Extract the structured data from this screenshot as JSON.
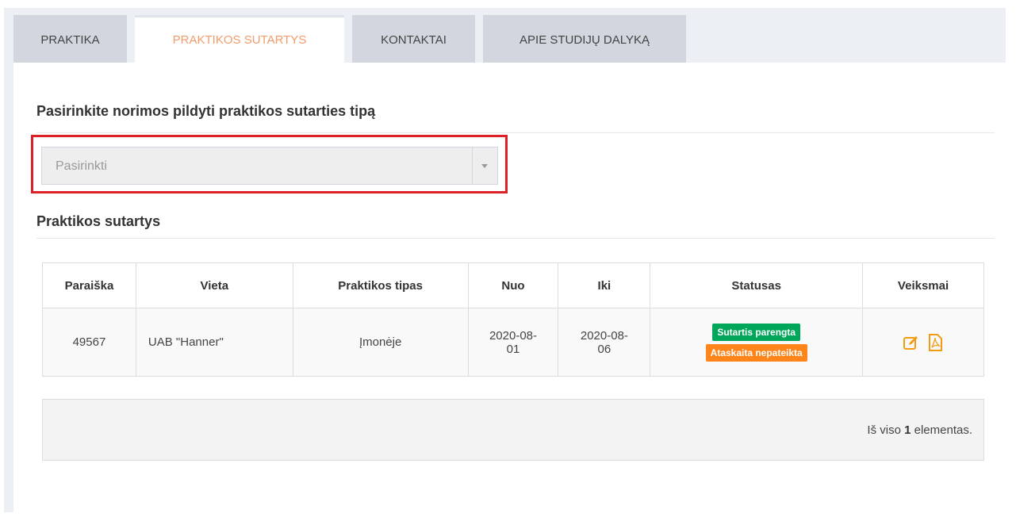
{
  "tabs": [
    {
      "label": "PRAKTIKA",
      "active": false
    },
    {
      "label": "PRAKTIKOS SUTARTYS",
      "active": true
    },
    {
      "label": "KONTAKTAI",
      "active": false
    },
    {
      "label": "APIE STUDIJŲ DALYKĄ",
      "active": false
    }
  ],
  "type_section": {
    "title": "Pasirinkite norimos pildyti praktikos sutarties tipą",
    "select_placeholder": "Pasirinkti"
  },
  "contracts_section": {
    "title": "Praktikos sutartys",
    "columns": [
      "Paraiška",
      "Vieta",
      "Praktikos tipas",
      "Nuo",
      "Iki",
      "Statusas",
      "Veiksmai"
    ],
    "rows": [
      {
        "application": "49567",
        "place": "UAB \"Hanner\"",
        "type": "Įmonėje",
        "from_line1": "2020-08-",
        "from_line2": "01",
        "to_line1": "2020-08-",
        "to_line2": "06",
        "status_primary": "Sutartis parengta",
        "status_secondary": "Ataskaita nepateikta",
        "actions": [
          "edit-icon",
          "pdf-icon"
        ]
      }
    ]
  },
  "summary": {
    "prefix": "Iš viso ",
    "count": "1",
    "suffix": " elementas."
  },
  "colors": {
    "active_tab_text": "#f39c6b",
    "highlight_border": "#dd1f26",
    "badge_green": "#00a65a",
    "badge_orange": "#ff851b",
    "action_icon": "#f39c12"
  }
}
